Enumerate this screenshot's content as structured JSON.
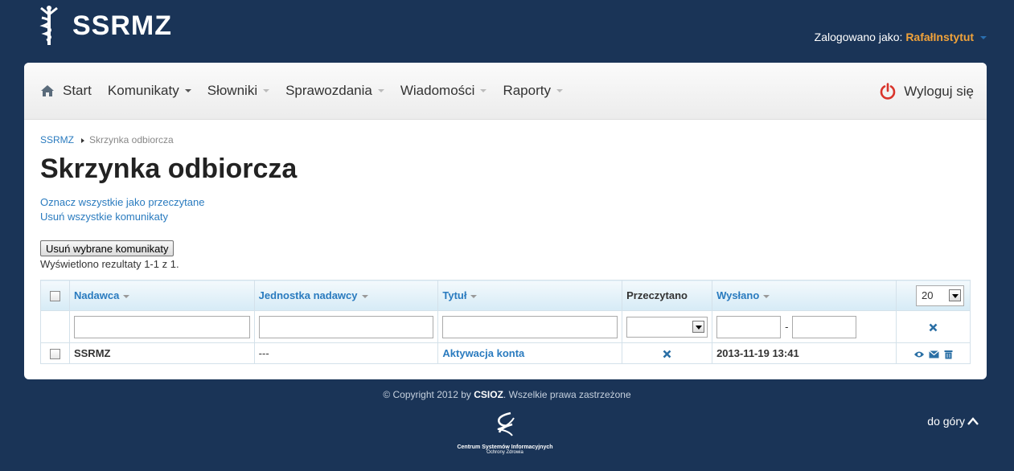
{
  "header": {
    "logo_text": "SSRMZ",
    "logged_as_label": "Zalogowano jako:",
    "username": "RafałInstytut"
  },
  "nav": {
    "items": [
      {
        "label": "Start"
      },
      {
        "label": "Komunikaty"
      },
      {
        "label": "Słowniki"
      },
      {
        "label": "Sprawozdania"
      },
      {
        "label": "Wiadomości"
      },
      {
        "label": "Raporty"
      }
    ],
    "logout_label": "Wyloguj się"
  },
  "breadcrumb": {
    "root": "SSRMZ",
    "current": "Skrzynka odbiorcza"
  },
  "page_title": "Skrzynka odbiorcza",
  "actions": {
    "mark_all_read": "Oznacz wszystkie jako przeczytane",
    "delete_all": "Usuń wszystkie komunikaty",
    "delete_selected": "Usuń wybrane komunikaty",
    "result_info": "Wyświetlono rezultaty 1-1 z 1."
  },
  "table": {
    "columns": [
      "Nadawca",
      "Jednostka nadawcy",
      "Tytuł",
      "Przeczytano",
      "Wysłano"
    ],
    "page_size": "20",
    "date_separator": "-",
    "rows": [
      {
        "sender": "SSRMZ",
        "unit": "---",
        "title": "Aktywacja konta",
        "sent": "2013-11-19 13:41"
      }
    ]
  },
  "footer": {
    "copyright_pre": "© Copyright 2012 by",
    "copyright_org": "CSIOZ",
    "copyright_post": ". Wszelkie prawa zastrzeżone",
    "csioz_line1": "Centrum Systemów Informacyjnych",
    "csioz_line2": "Ochrony Zdrowia",
    "to_top": "do góry"
  },
  "colors": {
    "background": "#1a3457",
    "accent": "#2a7bbf",
    "username": "#f0a23a",
    "power_icon": "#d9342b"
  }
}
